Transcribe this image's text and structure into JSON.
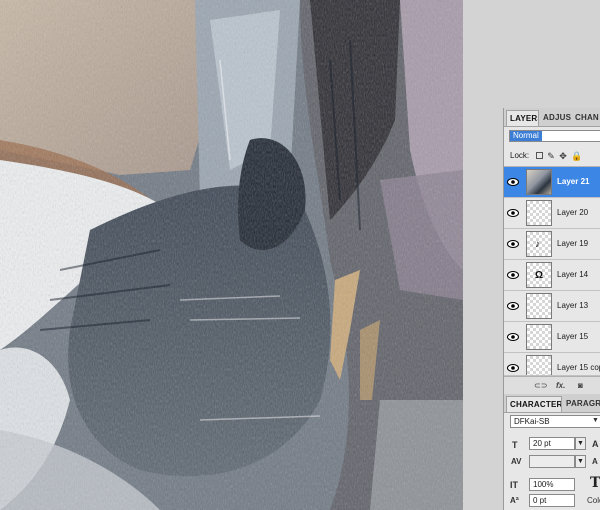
{
  "layers_panel": {
    "tabs": [
      "LAYERS",
      "ADJUS",
      "CHAN"
    ],
    "blend_mode": "Normal",
    "lock_label": "Lock:",
    "layers": [
      {
        "name": "Layer 21",
        "selected": true,
        "thumb": "image"
      },
      {
        "name": "Layer 20",
        "selected": false,
        "thumb": "transparent"
      },
      {
        "name": "Layer 19",
        "selected": false,
        "thumb": "brush-mark"
      },
      {
        "name": "Layer 14",
        "selected": false,
        "thumb": "brush-mark"
      },
      {
        "name": "Layer 13",
        "selected": false,
        "thumb": "transparent"
      },
      {
        "name": "Layer 15",
        "selected": false,
        "thumb": "transparent"
      },
      {
        "name": "Layer 15 cop",
        "selected": false,
        "thumb": "transparent"
      }
    ],
    "footer_icons": [
      "link-icon",
      "fx-icon",
      "mask-icon"
    ],
    "fx_label": "fx."
  },
  "character_panel": {
    "tabs": [
      "CHARACTER",
      "PARAGRA"
    ],
    "font_family": "DFKai-SB",
    "font_size": "20 pt",
    "tracking": "",
    "vertical_scale": "100%",
    "baseline_shift": "0 pt",
    "color_label": "Colo"
  },
  "colors": {
    "selection": "#3c86e6",
    "panel_bg": "#e7e7e7",
    "app_bg": "#d3d3d3"
  }
}
